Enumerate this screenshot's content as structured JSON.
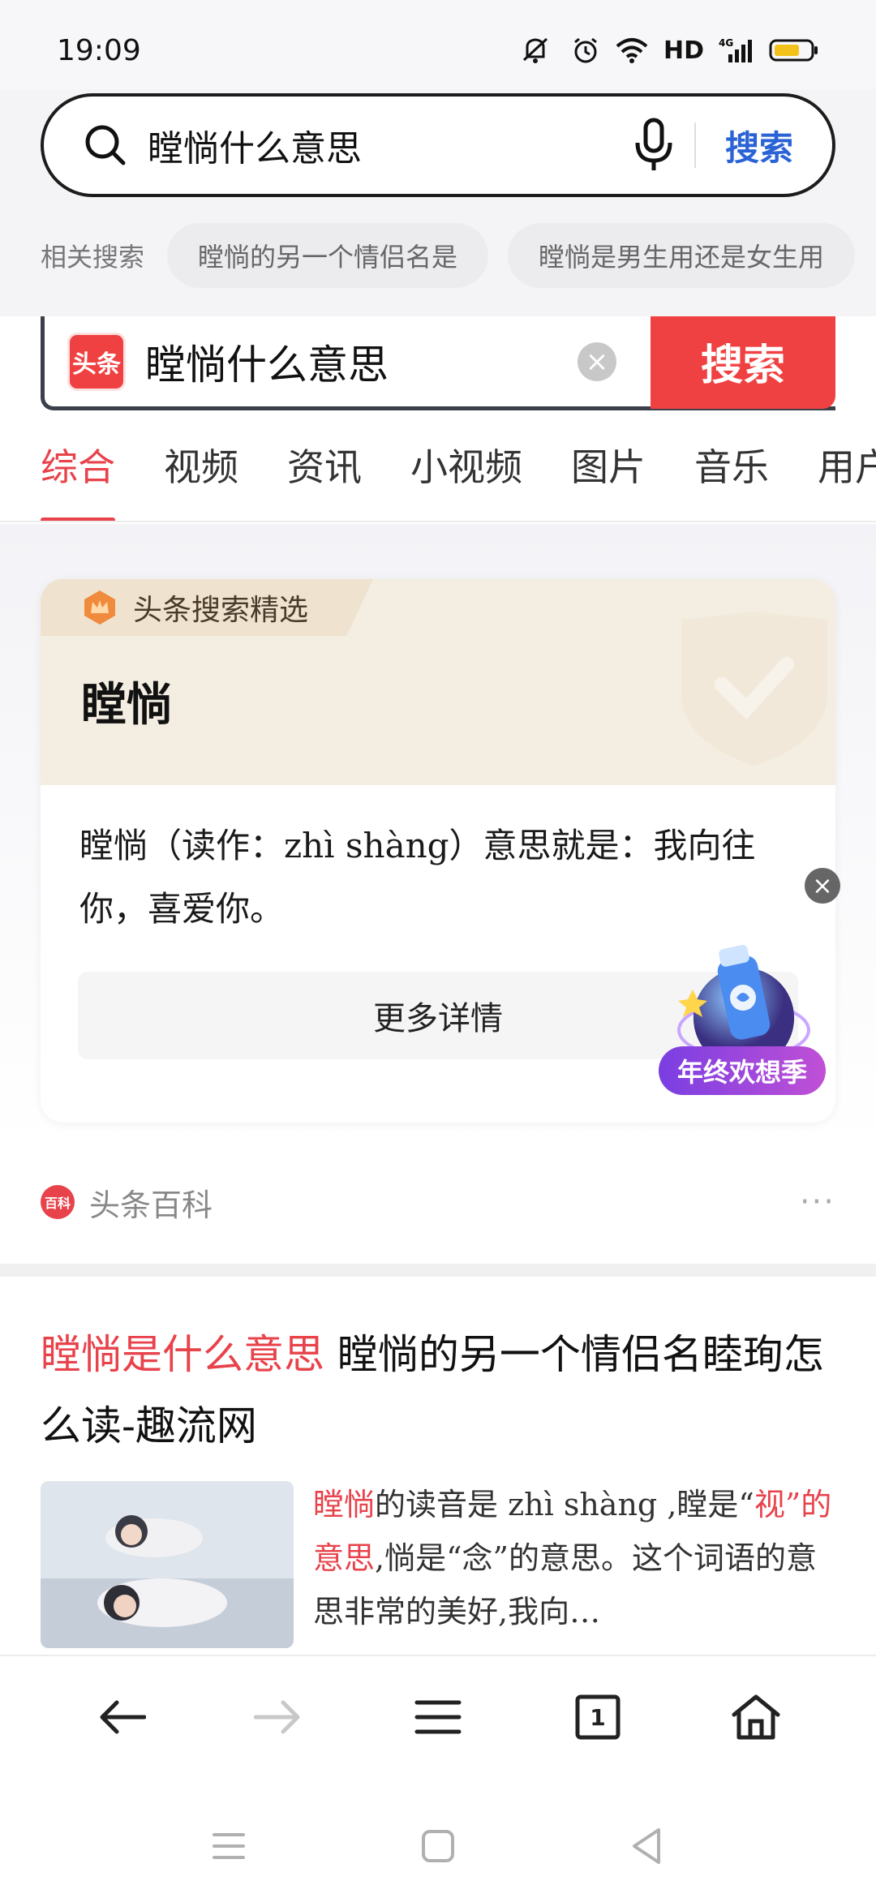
{
  "status_bar": {
    "time": "19:09",
    "network": "HD",
    "signal": "4G"
  },
  "browser_search": {
    "query": "瞠惝什么意思",
    "button": "搜索"
  },
  "related": {
    "label": "相关搜索",
    "chips": [
      "瞠惝的另一个情侣名是",
      "瞠惝是男生用还是女生用"
    ]
  },
  "toutiao_search": {
    "logo": "头条",
    "query": "瞠惝什么意思",
    "button": "搜索"
  },
  "tabs": [
    "综合",
    "视频",
    "资讯",
    "小视频",
    "图片",
    "音乐",
    "用户"
  ],
  "card": {
    "tag": "头条搜索精选",
    "title": "瞠惝",
    "body": "瞠惝（读作：zhì shàng）意思就是：我向往你，喜爱你。",
    "more": "更多详情"
  },
  "promo": {
    "label": "年终欢想季"
  },
  "source": {
    "icon": "百科",
    "name": "头条百科",
    "more": "···"
  },
  "result": {
    "title_hl": "瞠惝是什么意思",
    "title_rest": " 瞠惝的另一个情侣名睦珣怎么读-趣流网",
    "snippet_hl1": "瞠惝",
    "snippet_1": "的读音是 zhì shàng ,瞠是“",
    "snippet_hl2": "视”的意思",
    "snippet_2": ",惝是“念”的意思。这个词语的意思非常的美好,我向…"
  },
  "bottom_nav": {
    "icons": [
      "back-arrow-icon",
      "forward-arrow-icon",
      "menu-icon",
      "tabs-icon",
      "home-icon"
    ],
    "tab_count": "1"
  },
  "colors": {
    "accent": "#e8424b",
    "search_blue": "#2a63d6",
    "toutiao_red": "#f04142"
  }
}
